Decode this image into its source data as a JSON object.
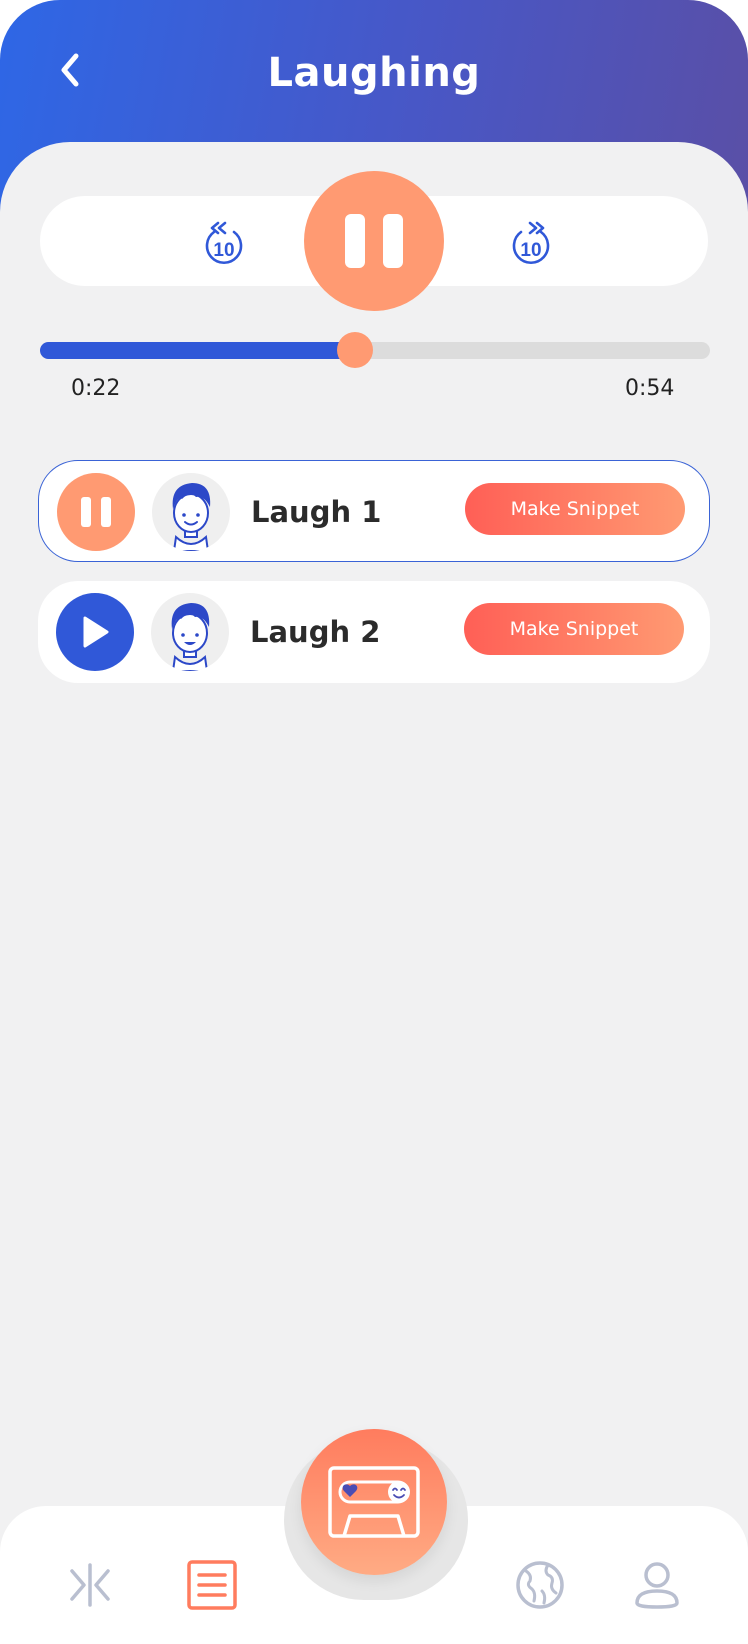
{
  "header": {
    "title": "Laughing",
    "back_icon": "chevron-left-icon"
  },
  "player": {
    "skip_back_icon": "replay-10-icon",
    "skip_back_label": "10",
    "skip_forward_icon": "forward-10-icon",
    "skip_forward_label": "10",
    "state_icon": "pause-icon",
    "progress_fraction": 0.47,
    "time_current": "0:22",
    "time_total": "0:54"
  },
  "tracks": [
    {
      "name": "Laugh 1",
      "state_icon": "pause-icon",
      "avatar_icon": "boy-avatar-icon",
      "snippet_label": "Make Snippet",
      "selected": true
    },
    {
      "name": "Laugh 2",
      "state_icon": "play-icon",
      "avatar_icon": "boy-avatar-icon",
      "snippet_label": "Make Snippet",
      "selected": false
    }
  ],
  "tabbar": {
    "items": [
      {
        "icon": "split-arrows-icon",
        "active": false
      },
      {
        "icon": "list-icon",
        "active": true
      },
      {
        "icon": "cassette-icon",
        "active": false
      },
      {
        "icon": "globe-icon",
        "active": false
      },
      {
        "icon": "profile-icon",
        "active": false
      }
    ]
  },
  "colors": {
    "header_start": "#2e67e6",
    "header_end": "#5a4fa6",
    "accent_orange": "#ff9a72",
    "accent_blue": "#3058d8",
    "snippet_gradient_start": "#ff5f56",
    "inactive_icon": "#b9bfd0"
  }
}
